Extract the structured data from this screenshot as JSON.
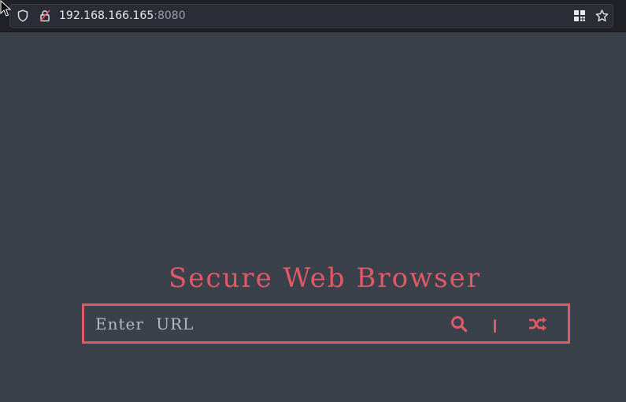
{
  "browser": {
    "url_host": "192.168.166.165",
    "url_port": ":8080",
    "icons": [
      "shield-icon",
      "lock-icon",
      "qr-code-icon",
      "bookmark-star-icon"
    ]
  },
  "page": {
    "title": "Secure Web Browser",
    "input_placeholder": "Enter URL",
    "input_value": "",
    "search_icon": "search-icon",
    "random_icon": "shuffle-icon"
  },
  "colors": {
    "background": "#3a414b",
    "accent": "#e05a66",
    "chrome": "#1f2127"
  }
}
